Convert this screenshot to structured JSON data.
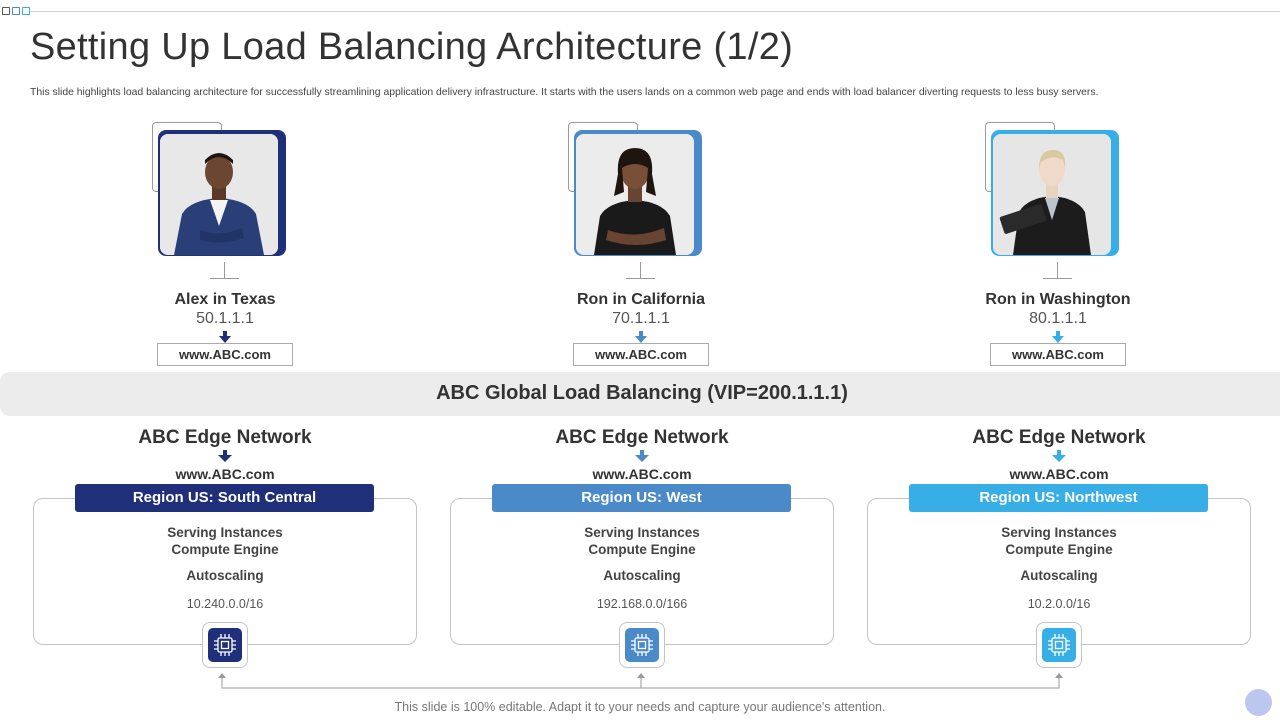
{
  "header": {
    "title": "Setting Up Load Balancing Architecture (1/2)",
    "subtitle": "This slide highlights load balancing architecture for successfully streamlining application delivery infrastructure. It starts with the users lands on a common  web page and ends with load balancer diverting requests to less busy servers."
  },
  "users": [
    {
      "name": "Alex in Texas",
      "ip": "50.1.1.1",
      "url": "www.ABC.com",
      "accent": "#1f2f7a"
    },
    {
      "name": "Ron in California",
      "ip": "70.1.1.1",
      "url": "www.ABC.com",
      "accent": "#4a8ac9"
    },
    {
      "name": "Ron in Washington",
      "ip": "80.1.1.1",
      "url": "www.ABC.com",
      "accent": "#38aee6"
    }
  ],
  "load_balancer": {
    "label": "ABC Global Load Balancing (VIP=200.1.1.1)"
  },
  "regions": [
    {
      "edge_label": "ABC Edge Network",
      "url": "www.ABC.com",
      "region_label": "Region US: South Central",
      "serving_line1": "Serving Instances",
      "serving_line2": "Compute Engine",
      "autoscaling": "Autoscaling",
      "cidr": "10.240.0.0/16",
      "color": "#1f2f7a"
    },
    {
      "edge_label": "ABC Edge Network",
      "url": "www.ABC.com",
      "region_label": "Region US: West",
      "serving_line1": "Serving Instances",
      "serving_line2": "Compute Engine",
      "autoscaling": "Autoscaling",
      "cidr": "192.168.0.0/166",
      "color": "#4a8ac9"
    },
    {
      "edge_label": "ABC Edge Network",
      "url": "www.ABC.com",
      "region_label": "Region US: Northwest",
      "serving_line1": "Serving Instances",
      "serving_line2": "Compute Engine",
      "autoscaling": "Autoscaling",
      "cidr": "10.2.0.0/16",
      "color": "#38aee6"
    }
  ],
  "footer": {
    "text": "This slide is 100% editable. Adapt it to your needs and capture your audience's attention."
  },
  "icons": {
    "arrow": "arrow-down-icon",
    "chip": "cpu-chip-icon",
    "person": "person-photo"
  }
}
